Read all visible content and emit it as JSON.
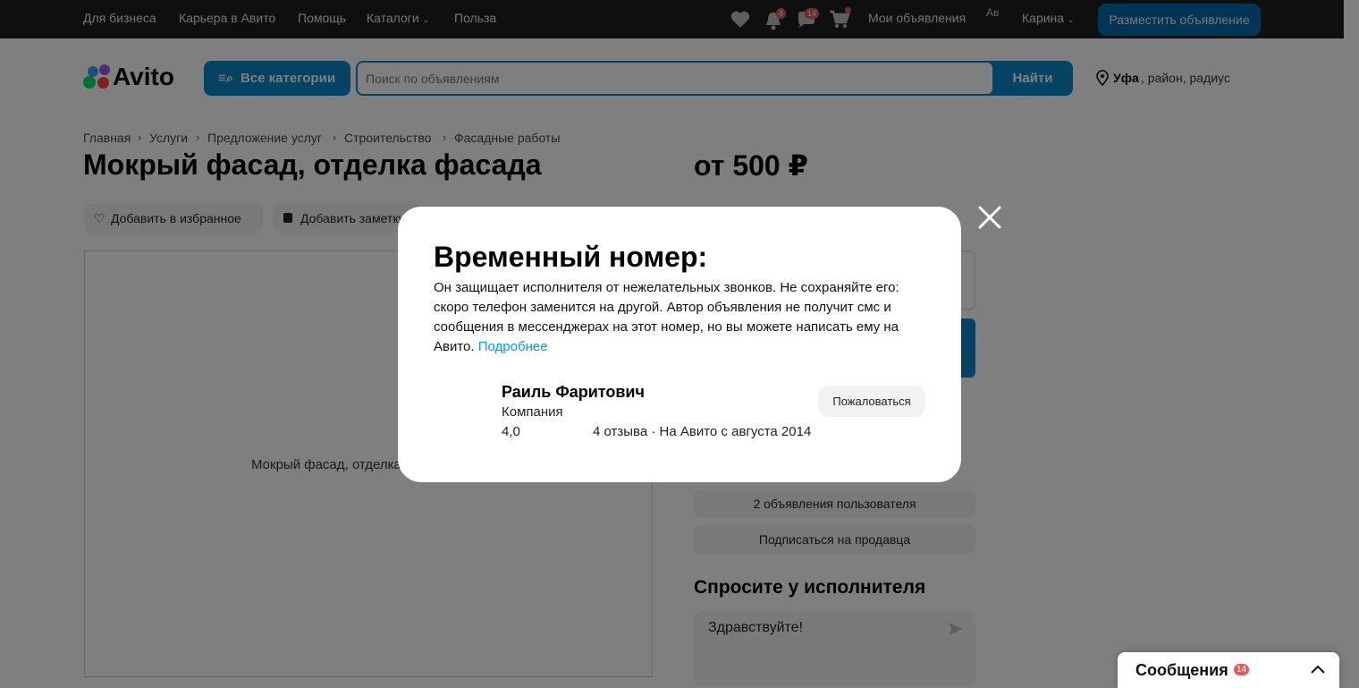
{
  "topbar": {
    "links": [
      "Для бизнеса",
      "Карьера в Авито",
      "Помощь",
      "Каталоги",
      "Польза"
    ],
    "badge_notifications": "4",
    "badge_messages": "14",
    "my_ads": "Мои объявления",
    "avatar_alt": "Ав",
    "user_name": "Карина",
    "post_button": "Разместить объявление"
  },
  "header": {
    "logo": "Avito",
    "all_categories": "Все категории",
    "search_placeholder": "Поиск по объявлениям",
    "search_button": "Найти",
    "location_bold": "Уфа",
    "location_rest": ", район, радиус"
  },
  "breadcrumbs": [
    "Главная",
    "Услуги",
    "Предложение услуг",
    "Строительство",
    "Фасадные работы"
  ],
  "listing": {
    "title": "Мокрый фасад, отделка фасада",
    "price": "от 500 ₽",
    "add_favorite": "Добавить в избранное",
    "add_note": "Добавить заметку",
    "image_alt": "Мокрый фасад, отделка фасада"
  },
  "seller_side": {
    "ads_count": "2 объявления пользователя",
    "subscribe": "Подписаться на продавца"
  },
  "ask": {
    "title": "Спросите у исполнителя",
    "input_value": "Здравствуйте!"
  },
  "messages_panel": {
    "label": "Сообщения",
    "badge": "14"
  },
  "modal": {
    "title": "Временный номер:",
    "text": "Он защищает исполнителя от нежелательных звонков. Не сохраняйте его: скоро телефон заменится на другой. Автор объявления не получит смс и сообщения в мессенджерах на этот номер, но вы можете написать ему на Авито.",
    "link": "Подробнее",
    "seller_name": "Раиль Фаритович",
    "seller_type": "Компания",
    "rating": "4,0",
    "reviews": "4 отзыва · На Авито с августа 2014",
    "complain_button": "Пожаловаться"
  },
  "colors": {
    "brand_blue": "#0a85c8",
    "link_blue": "#0099f7",
    "badge_red": "#e05a5a"
  }
}
